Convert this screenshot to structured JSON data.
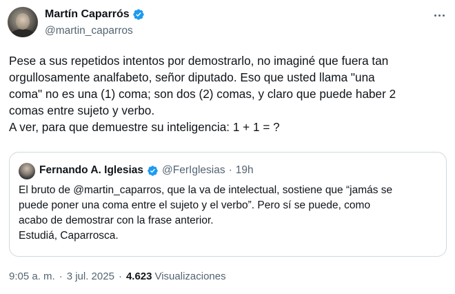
{
  "author": {
    "name": "Martín Caparrós",
    "handle": "@martin_caparros"
  },
  "tweet": {
    "lines": [
      "Pese a sus repetidos intentos por demostrarlo, no imaginé que fuera tan",
      "orgullosamente analfabeto, señor diputado. Eso que usted llama \"una",
      "coma\" no es una (1) coma; son dos (2) comas, y claro que puede haber 2",
      "comas entre sujeto y verbo.",
      "A ver, para que demuestre su inteligencia: 1 + 1 = ?"
    ]
  },
  "quote": {
    "name": "Fernando A. Iglesias",
    "handle": "@FerIglesias",
    "separator": "·",
    "time": "19h",
    "lines": [
      "El bruto de @martin_caparros, que la va de intelectual, sostiene que “jamás se",
      "puede poner una coma entre el sujeto y el verbo”. Pero sí se puede, como",
      "acabo de demostrar con la frase anterior.",
      "Estudiá, Caparrosca."
    ]
  },
  "meta": {
    "time": "9:05 a. m.",
    "separator": "·",
    "date": "3 jul. 2025",
    "views_count": "4.623",
    "views_label": "Visualizaciones"
  },
  "icons": {
    "verified": "verified-badge-icon",
    "more": "more-options-icon"
  },
  "colors": {
    "verified": "#1d9bf0",
    "text": "#0f1419",
    "secondary": "#536471",
    "border": "#cfd9de"
  }
}
